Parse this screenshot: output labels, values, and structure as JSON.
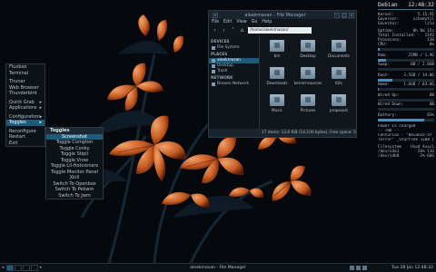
{
  "root_menu": {
    "items": [
      {
        "label": "Fluxbox",
        "arrow": ""
      },
      {
        "label": "Terminal",
        "arrow": ""
      },
      {
        "sep": true
      },
      {
        "label": "Thunar",
        "arrow": ""
      },
      {
        "label": "Web Browser",
        "arrow": ""
      },
      {
        "label": "Thunderbird",
        "arrow": ""
      },
      {
        "sep": true
      },
      {
        "label": "Quick Grab",
        "arrow": "▸"
      },
      {
        "label": "Applications",
        "arrow": "▸"
      },
      {
        "sep": true
      },
      {
        "label": "Configuration",
        "arrow": "▸"
      },
      {
        "label": "Toggles",
        "arrow": "▸",
        "active": true
      },
      {
        "sep": true
      },
      {
        "label": "Reconfigure",
        "arrow": ""
      },
      {
        "label": "Restart",
        "arrow": ""
      },
      {
        "label": "Exit",
        "arrow": ""
      }
    ]
  },
  "toggles_menu": {
    "title": "Toggles",
    "items": [
      {
        "label": "Screenshot",
        "active": true
      },
      {
        "label": "Toggle Compton"
      },
      {
        "label": "Toggle Conky"
      },
      {
        "label": "Toggle Stipli"
      },
      {
        "label": "Toggle Vrow"
      },
      {
        "label": "Toggle Lil-Hotcorners"
      },
      {
        "label": "Toggle Monitor Panel"
      },
      {
        "label": "Xkill"
      },
      {
        "label": "Switch To Openbox"
      },
      {
        "label": "Switch To Pekwm"
      },
      {
        "label": "Switch To Jwm"
      }
    ]
  },
  "file_manager": {
    "title": "aleekmasan - File Manager",
    "menubar": [
      "File",
      "Edit",
      "View",
      "Go",
      "Help"
    ],
    "location": "/home/aleekmasan/",
    "sidebar": {
      "devices_header": "DEVICES",
      "devices": [
        "File System"
      ],
      "places_header": "PLACES",
      "places": [
        {
          "label": "aleekmasan",
          "selected": true
        },
        {
          "label": "Desktop"
        },
        {
          "label": "Trash"
        }
      ],
      "network_header": "NETWORK",
      "network": [
        "Browse Network"
      ]
    },
    "items": [
      "bin",
      "Desktop",
      "Documents",
      "Downloads",
      "kernel-sources",
      "Kits",
      "Music",
      "Pictures",
      "proposals"
    ],
    "status": "17 items: 13.6 KiB (14,100 bytes), Free space: 59..."
  },
  "conky": {
    "host": "Debian",
    "time": "12:48:32",
    "kernel_rows": [
      {
        "k": "Kernel:",
        "v": "5.15.91"
      },
      {
        "k": "Governor:",
        "v": "schedutil"
      },
      {
        "k": "Governor:",
        "v": "lzlo"
      }
    ],
    "sys_rows": [
      {
        "k": "Uptime:",
        "v": "0h 0m 15s"
      },
      {
        "k": "Total Installed:",
        "v": "1192"
      },
      {
        "k": "Processes:",
        "v": "130"
      },
      {
        "k": "CPU:",
        "v": "0%"
      }
    ],
    "cpu_pct": 0.04,
    "ram": {
      "k": "Ram:",
      "v": "25MB / 1.9G",
      "pct": 0.14
    },
    "swap": {
      "k": "Swap:",
      "v": "0B / 2.0GB",
      "pct": 0.0
    },
    "root": {
      "k": "Root:",
      "v": "3.5GB / 14.0G",
      "pct": 0.25
    },
    "home": {
      "k": "Home:",
      "v": "1.6GB / 83.0G",
      "pct": 0.02
    },
    "wired_up": {
      "k": "Wired Up:",
      "v": "0B"
    },
    "wired_down": {
      "k": "Wired Down:",
      "v": "0B"
    },
    "battery": {
      "k": "Battery:",
      "v": "83%",
      "pct": 0.83
    },
    "power_line": "Power is charged",
    "music_lines": [
      "-- TBD --",
      "Centurion - \"Balance of",
      "Terror\" _Startrek 1x08 |"
    ],
    "fs_header": [
      "Filesystem",
      "Used Avail"
    ],
    "fs_rows": [
      {
        "k": "/dev/sda1",
        "v": "26%   11G"
      },
      {
        "k": "/dev/sdb8",
        "v": "2%   66G"
      }
    ]
  },
  "taskbar": {
    "window": "aleekmasan - File Manager",
    "clock": "Tue 28 Jan 12:48:32"
  }
}
